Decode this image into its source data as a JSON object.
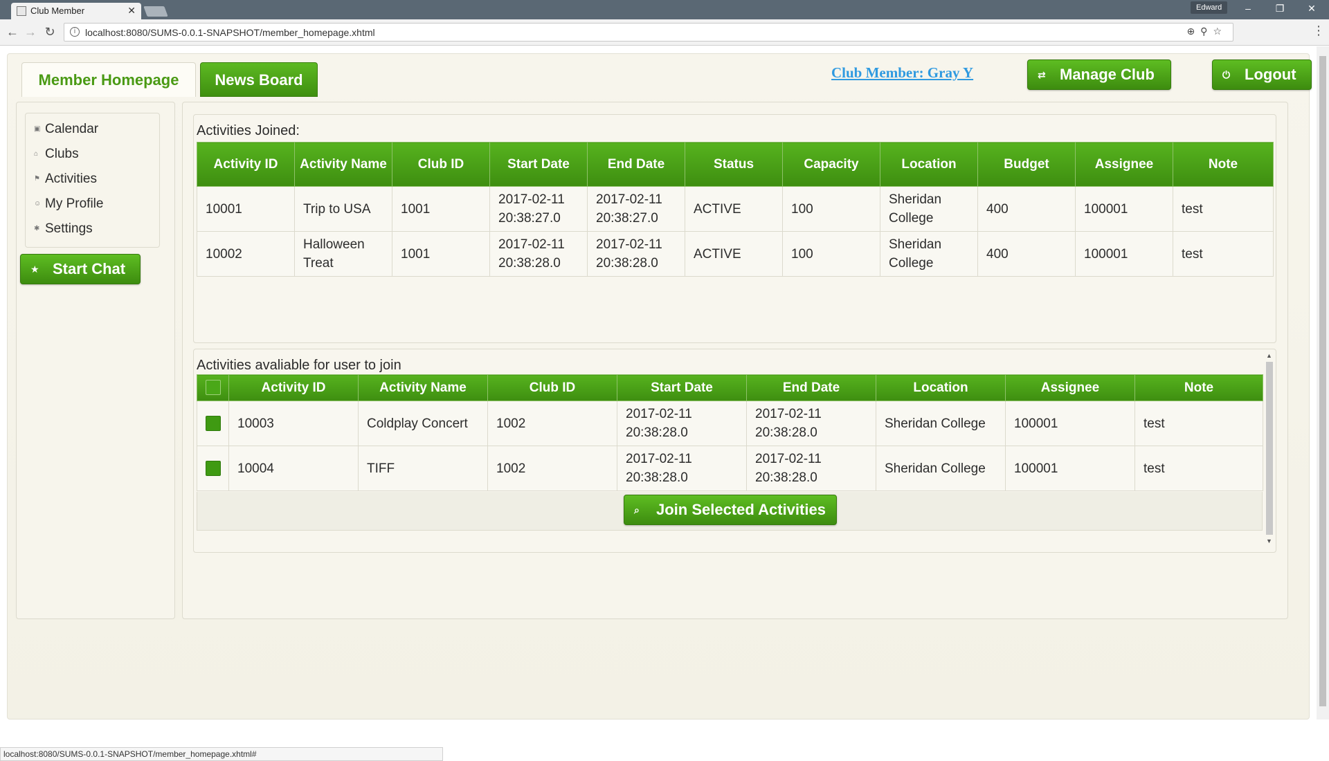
{
  "browser": {
    "tab_title": "Club Member",
    "tab_close": "✕",
    "user": "Edward",
    "url": "localhost:8080/SUMS-0.0.1-SNAPSHOT/member_homepage.xhtml",
    "status_url": "localhost:8080/SUMS-0.0.1-SNAPSHOT/member_homepage.xhtml#",
    "win_min": "–",
    "win_restore": "❐",
    "win_close": "✕"
  },
  "header": {
    "tabs": [
      {
        "label": "Member Homepage",
        "active": true
      },
      {
        "label": "News Board",
        "active": false
      }
    ],
    "member_link": "Club Member: Gray Y",
    "manage_label": "Manage Club",
    "manage_icon": "⇄",
    "logout_label": "Logout",
    "logout_icon": "⏻"
  },
  "sidebar": {
    "items": [
      {
        "label": "Calendar",
        "icon": "calendar-icon"
      },
      {
        "label": "Clubs",
        "icon": "home-icon"
      },
      {
        "label": "Activities",
        "icon": "flag-icon"
      },
      {
        "label": "My Profile",
        "icon": "person-icon"
      },
      {
        "label": "Settings",
        "icon": "gear-icon"
      }
    ],
    "start_chat_label": "Start Chat",
    "start_chat_icon": "★"
  },
  "joined": {
    "title": "Activities Joined:",
    "headers": [
      "Activity ID",
      "Activity Name",
      "Club ID",
      "Start Date",
      "End Date",
      "Status",
      "Capacity",
      "Location",
      "Budget",
      "Assignee",
      "Note"
    ],
    "rows": [
      [
        "10001",
        "Trip to USA",
        "1001",
        "2017-02-11 20:38:27.0",
        "2017-02-11 20:38:27.0",
        "ACTIVE",
        "100",
        "Sheridan College",
        "400",
        "100001",
        "test"
      ],
      [
        "10002",
        "Halloween Treat",
        "1001",
        "2017-02-11 20:38:28.0",
        "2017-02-11 20:38:28.0",
        "ACTIVE",
        "100",
        "Sheridan College",
        "400",
        "100001",
        "test"
      ]
    ]
  },
  "available": {
    "title": "Activities avaliable for user to join",
    "headers": [
      "Activity ID",
      "Activity Name",
      "Club ID",
      "Start Date",
      "End Date",
      "Location",
      "Assignee",
      "Note"
    ],
    "rows": [
      [
        "10003",
        "Coldplay Concert",
        "1002",
        "2017-02-11 20:38:28.0",
        "2017-02-11 20:38:28.0",
        "Sheridan College",
        "100001",
        "test"
      ],
      [
        "10004",
        "TIFF",
        "1002",
        "2017-02-11 20:38:28.0",
        "2017-02-11 20:38:28.0",
        "Sheridan College",
        "100001",
        "test"
      ]
    ],
    "join_label": "Join Selected Activities",
    "join_icon": "⌕"
  },
  "colors": {
    "accent_green": "#4a9a14",
    "link_blue": "#2f9ae0"
  }
}
